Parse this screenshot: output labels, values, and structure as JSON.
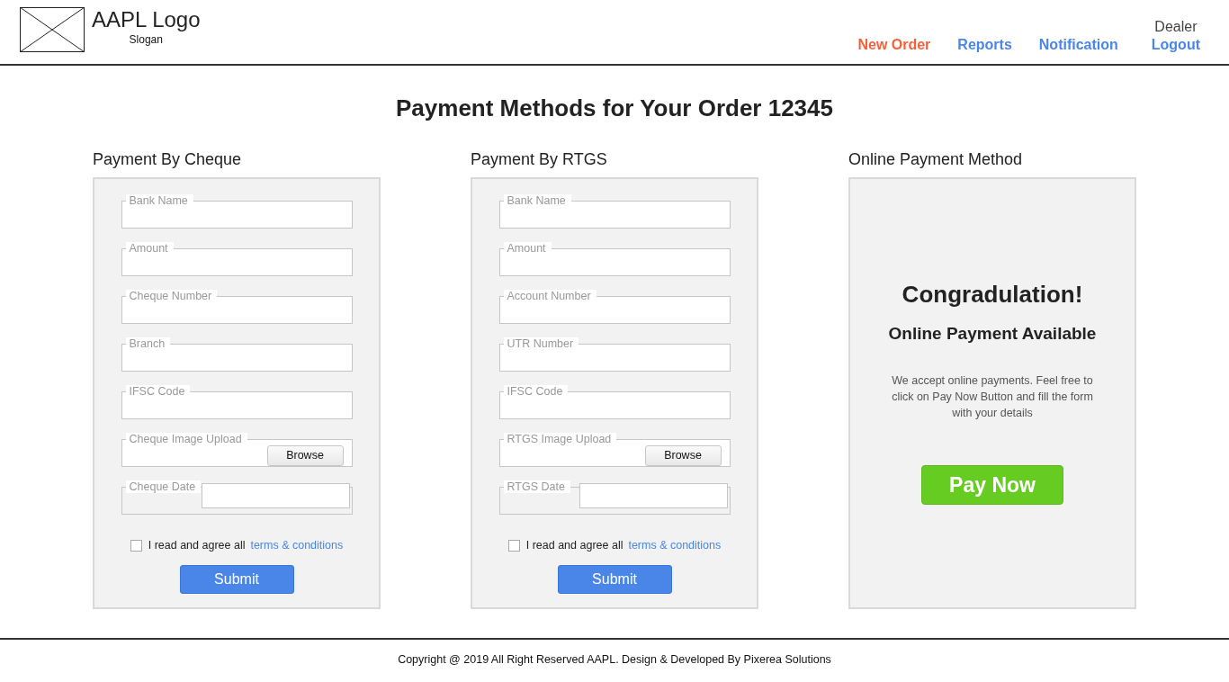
{
  "header": {
    "logo_title": "AAPL Logo",
    "slogan": "Slogan",
    "nav": [
      {
        "label": "New Order",
        "selected": true
      },
      {
        "label": "Reports",
        "selected": false
      },
      {
        "label": "Notification",
        "selected": false
      }
    ],
    "user": {
      "role": "Dealer",
      "logout": "Logout"
    }
  },
  "page_title": "Payment Methods for Your Order 12345",
  "panels": [
    {
      "kind": "form",
      "title": "Payment By Cheque",
      "fields": [
        {
          "kind": "text",
          "label": "Bank Name"
        },
        {
          "kind": "text",
          "label": "Amount"
        },
        {
          "kind": "text",
          "label": "Cheque Number"
        },
        {
          "kind": "text",
          "label": "Branch"
        },
        {
          "kind": "text",
          "label": "IFSC Code"
        },
        {
          "kind": "upload",
          "label": "Cheque Image Upload",
          "button": "Browse"
        },
        {
          "kind": "date",
          "label": "Cheque Date"
        }
      ],
      "agree": {
        "checked": false,
        "text": "I read and agree all",
        "link": "terms & conditions"
      },
      "submit": "Submit"
    },
    {
      "kind": "form",
      "title": "Payment By RTGS",
      "fields": [
        {
          "kind": "text",
          "label": "Bank Name"
        },
        {
          "kind": "text",
          "label": "Amount"
        },
        {
          "kind": "text",
          "label": "Account Number"
        },
        {
          "kind": "text",
          "label": "UTR Number"
        },
        {
          "kind": "text",
          "label": "IFSC Code"
        },
        {
          "kind": "upload",
          "label": "RTGS Image Upload",
          "button": "Browse"
        },
        {
          "kind": "date",
          "label": "RTGS Date"
        }
      ],
      "agree": {
        "checked": false,
        "text": "I read and agree all",
        "link": "terms & conditions"
      },
      "submit": "Submit"
    },
    {
      "kind": "online",
      "title": "Online Payment Method",
      "heading": "Congradulation!",
      "subheading": "Online Payment Available",
      "description": "We accept online payments. Feel free to click on Pay Now Button and fill the form with your details",
      "button": "Pay Now"
    }
  ],
  "footer": "Copyright @ 2019 All Right Reserved AAPL. Design & Developed By Pixerea Solutions"
}
